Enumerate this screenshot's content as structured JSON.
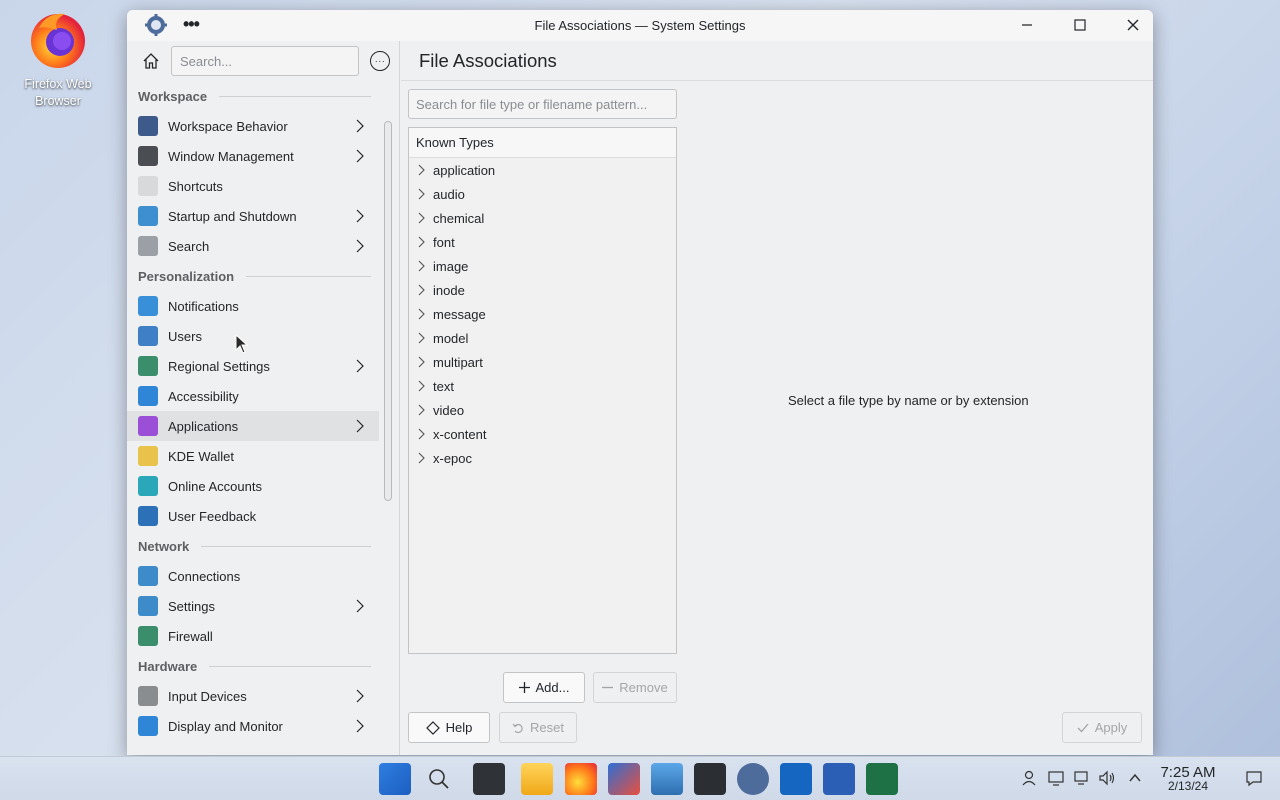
{
  "desktop": {
    "icon_label": "Firefox Web Browser"
  },
  "window": {
    "title": "File Associations — System Settings",
    "menu_dots": "•••"
  },
  "sidebar": {
    "search_placeholder": "Search...",
    "more_glyph": "···",
    "sections": [
      {
        "title": "Workspace",
        "items": [
          {
            "label": "Workspace Behavior",
            "icon": "workspace-behavior-icon",
            "color": "#3d5a8a",
            "chevron": true
          },
          {
            "label": "Window Management",
            "icon": "window-management-icon",
            "color": "#4a4d52",
            "chevron": true
          },
          {
            "label": "Shortcuts",
            "icon": "keyboard-icon",
            "color": "#d8d9db",
            "chevron": false
          },
          {
            "label": "Startup and Shutdown",
            "icon": "startup-icon",
            "color": "#3e8fcf",
            "chevron": true
          },
          {
            "label": "Search",
            "icon": "search-icon",
            "color": "#9aa0a6",
            "chevron": true
          }
        ]
      },
      {
        "title": "Personalization",
        "items": [
          {
            "label": "Notifications",
            "icon": "notifications-icon",
            "color": "#3a8fd9",
            "chevron": false
          },
          {
            "label": "Users",
            "icon": "users-icon",
            "color": "#3e7fc6",
            "chevron": false
          },
          {
            "label": "Regional Settings",
            "icon": "globe-icon",
            "color": "#3b8e6c",
            "chevron": true
          },
          {
            "label": "Accessibility",
            "icon": "accessibility-icon",
            "color": "#2f86d6",
            "chevron": false
          },
          {
            "label": "Applications",
            "icon": "applications-icon",
            "color": "#9b4fd6",
            "chevron": true,
            "active": true
          },
          {
            "label": "KDE Wallet",
            "icon": "key-icon",
            "color": "#e8c24a",
            "chevron": false
          },
          {
            "label": "Online Accounts",
            "icon": "online-accounts-icon",
            "color": "#2aa7b8",
            "chevron": false
          },
          {
            "label": "User Feedback",
            "icon": "user-feedback-icon",
            "color": "#2c70b8",
            "chevron": false
          }
        ]
      },
      {
        "title": "Network",
        "items": [
          {
            "label": "Connections",
            "icon": "connections-icon",
            "color": "#3d8bc9",
            "chevron": false
          },
          {
            "label": "Settings",
            "icon": "network-settings-icon",
            "color": "#3d8bc9",
            "chevron": true
          },
          {
            "label": "Firewall",
            "icon": "firewall-icon",
            "color": "#3b8e6c",
            "chevron": false
          }
        ]
      },
      {
        "title": "Hardware",
        "items": [
          {
            "label": "Input Devices",
            "icon": "mouse-icon",
            "color": "#8a8d90",
            "chevron": true
          },
          {
            "label": "Display and Monitor",
            "icon": "monitor-icon",
            "color": "#2f86d6",
            "chevron": true
          }
        ]
      }
    ]
  },
  "main": {
    "title": "File Associations",
    "type_search_placeholder": "Search for file type or filename pattern...",
    "tree_header": "Known Types",
    "types": [
      "application",
      "audio",
      "chemical",
      "font",
      "image",
      "inode",
      "message",
      "model",
      "multipart",
      "text",
      "video",
      "x-content",
      "x-epoc"
    ],
    "empty_message": "Select a file type by name or by extension",
    "add_label": "Add...",
    "remove_label": "Remove",
    "help_label": "Help",
    "reset_label": "Reset",
    "apply_label": "Apply"
  },
  "taskbar": {
    "apps": [
      "start-menu-icon",
      "search-icon",
      "widgets-icon",
      "file-explorer-icon",
      "firefox-icon",
      "store-icon",
      "photos-icon",
      "terminal-icon",
      "system-settings-icon",
      "outlook-icon",
      "word-icon",
      "excel-icon"
    ],
    "time": "7:25 AM",
    "date": "2/13/24"
  }
}
